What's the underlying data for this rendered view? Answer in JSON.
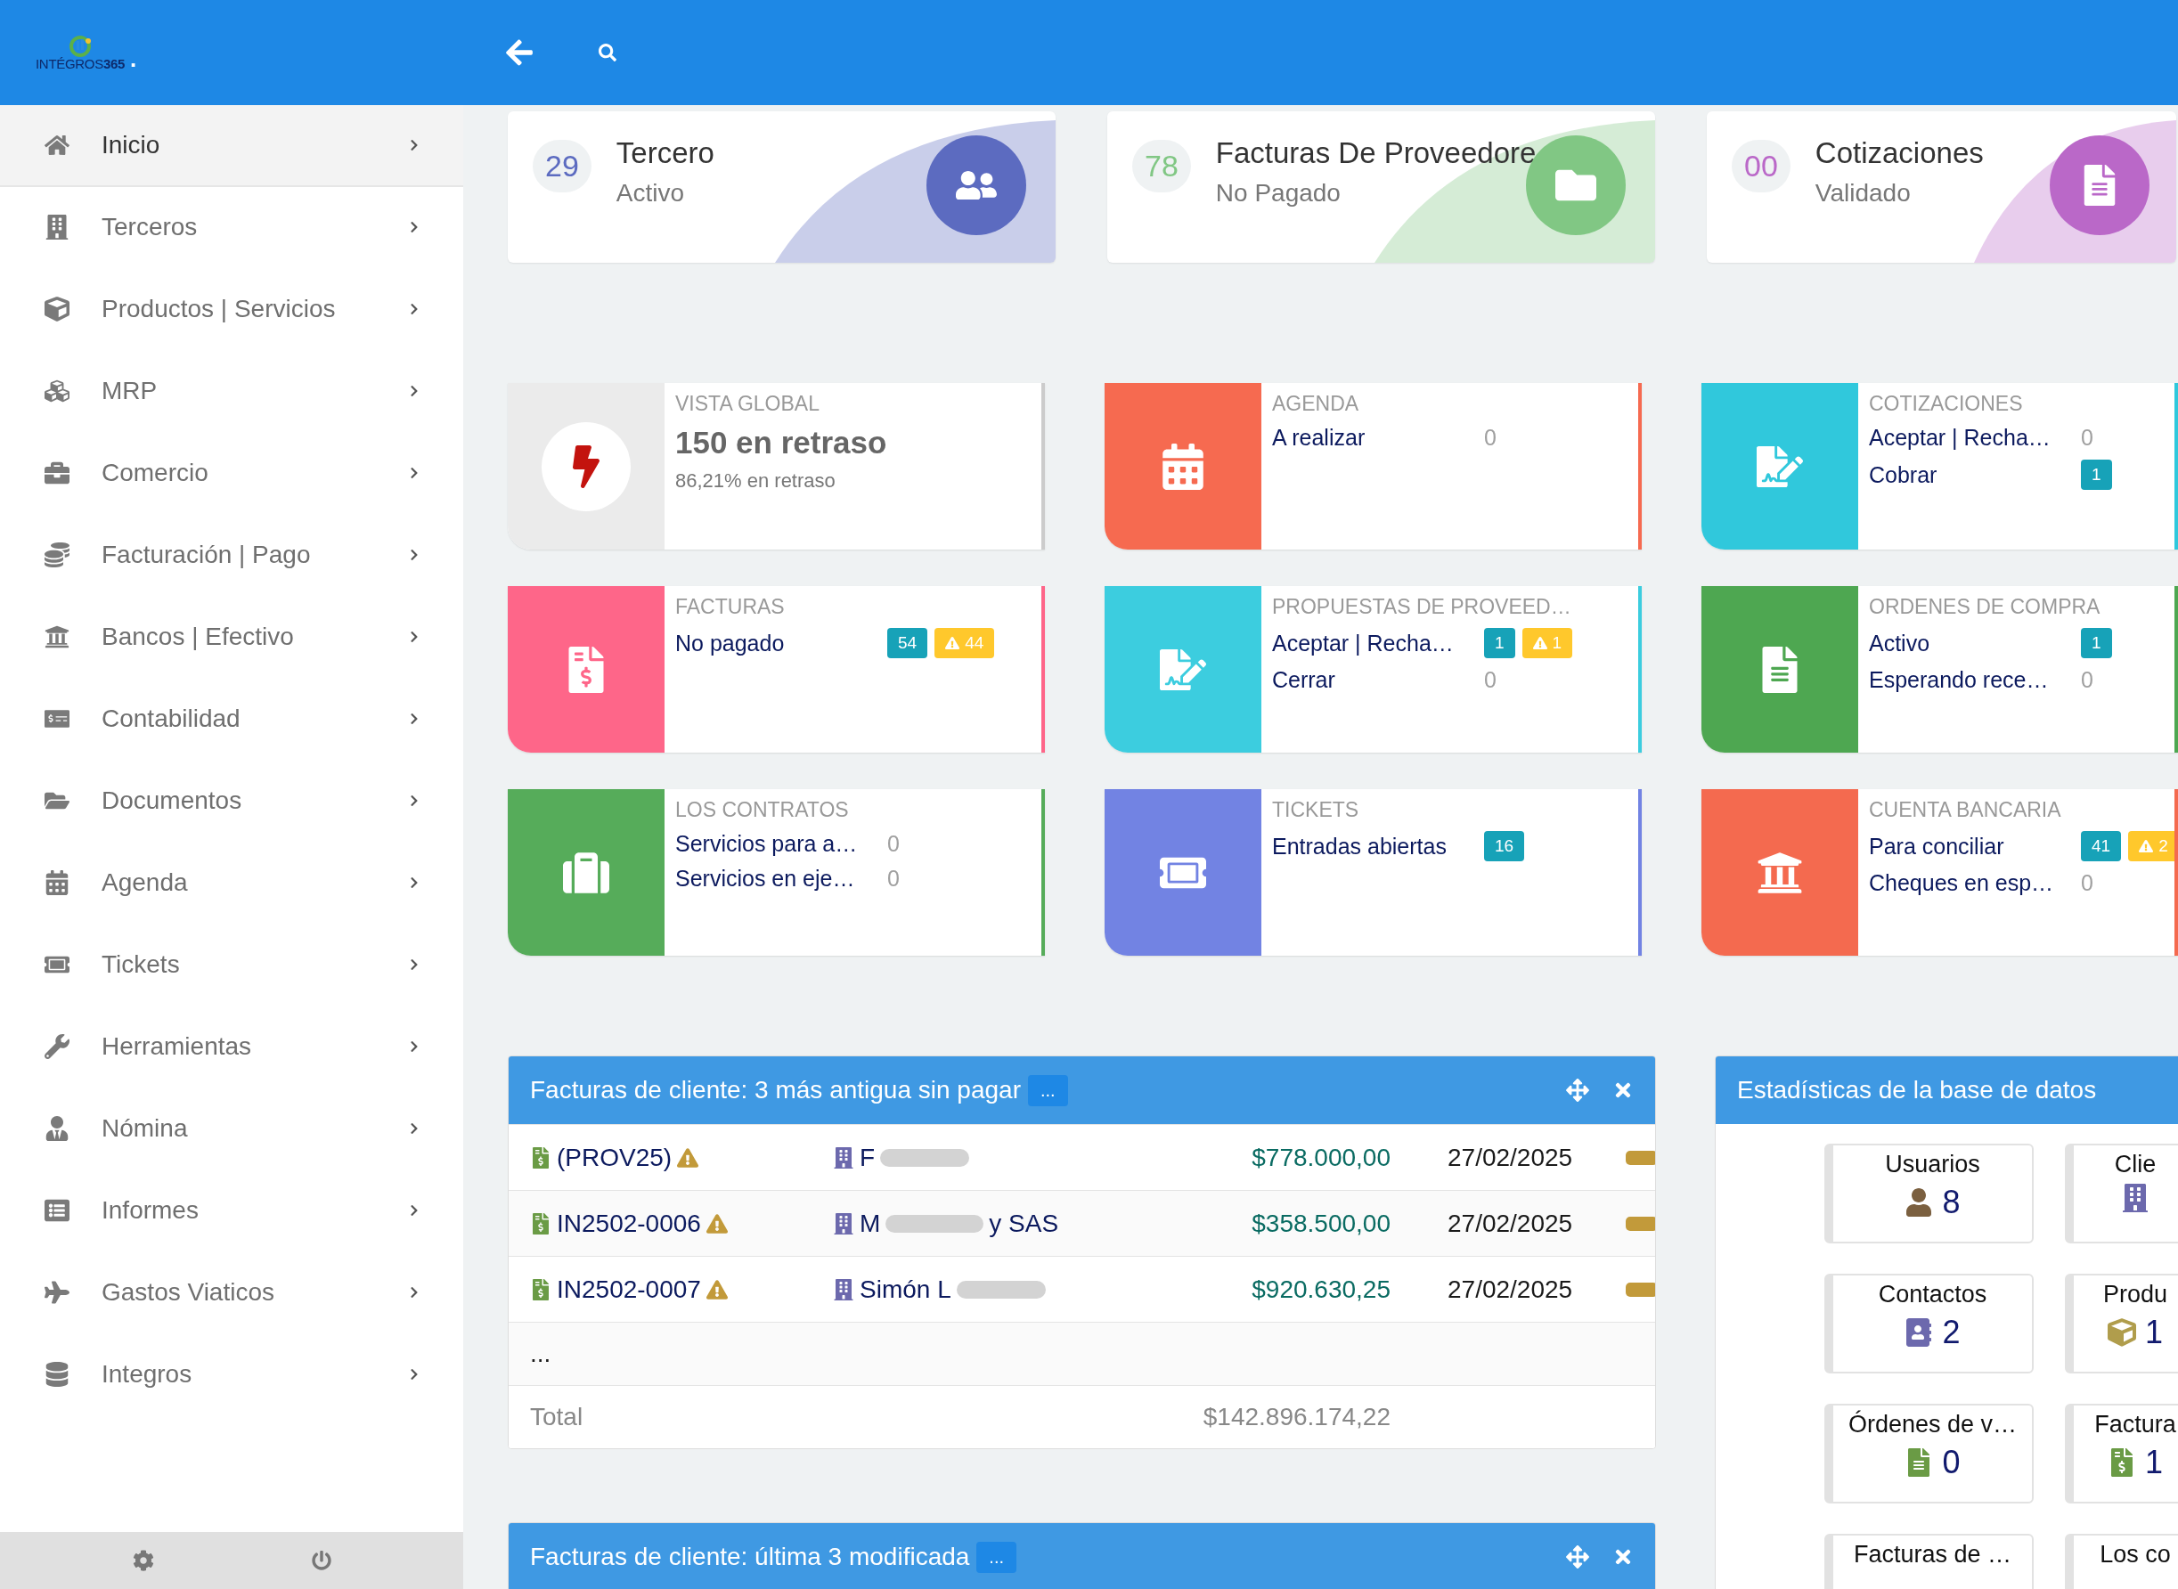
{
  "header": {
    "logo": {
      "name": "INTÉGROS",
      "suffix": "365",
      "dot": "."
    }
  },
  "sidebar": {
    "items": [
      {
        "label": "Inicio",
        "selected": true
      },
      {
        "label": "Terceros",
        "selected": false
      },
      {
        "label": "Productos | Servicios",
        "selected": false
      },
      {
        "label": "MRP",
        "selected": false
      },
      {
        "label": "Comercio",
        "selected": false
      },
      {
        "label": "Facturación | Pago",
        "selected": false
      },
      {
        "label": "Bancos | Efectivo",
        "selected": false
      },
      {
        "label": "Contabilidad",
        "selected": false
      },
      {
        "label": "Documentos",
        "selected": false
      },
      {
        "label": "Agenda",
        "selected": false
      },
      {
        "label": "Tickets",
        "selected": false
      },
      {
        "label": "Herramientas",
        "selected": false
      },
      {
        "label": "Nómina",
        "selected": false
      },
      {
        "label": "Informes",
        "selected": false
      },
      {
        "label": "Gastos Viaticos",
        "selected": false
      },
      {
        "label": "Integros",
        "selected": false
      }
    ]
  },
  "summary_cards": [
    {
      "count": "29",
      "title": "Tercero",
      "subtitle": "Activo",
      "color": "#5c6bc0"
    },
    {
      "count": "78",
      "title": "Facturas De Proveedore",
      "subtitle": "No Pagado",
      "color": "#81c784"
    },
    {
      "count": "00",
      "title": "Cotizaciones",
      "subtitle": "Validado",
      "color": "#ba68c8"
    }
  ],
  "boxes": [
    {
      "kind": "summary",
      "title": "VISTA GLOBAL",
      "value": "150 en retraso",
      "note": "86,21% en retraso",
      "color": "#ebebeb"
    },
    {
      "kind": "list",
      "title": "AGENDA",
      "color": "#f66a50",
      "lines": [
        {
          "label": "A realizar",
          "value": "0"
        }
      ]
    },
    {
      "kind": "list",
      "title": "COTIZACIONES",
      "color": "#30c8dc",
      "lines": [
        {
          "label": "Aceptar | Recha…",
          "value": "0"
        },
        {
          "label": "Cobrar",
          "badges": [
            {
              "kind": "info",
              "text": "1"
            }
          ]
        }
      ]
    },
    {
      "kind": "list",
      "title": "FACTURAS",
      "color": "#fe6689",
      "lines": [
        {
          "label": "No pagado",
          "badges": [
            {
              "kind": "info",
              "text": "54"
            },
            {
              "kind": "warning",
              "text": "44"
            }
          ]
        }
      ]
    },
    {
      "kind": "list",
      "title": "PROPUESTAS DE PROVEED…",
      "color": "#3ccddf",
      "lines": [
        {
          "label": "Aceptar | Recha…",
          "badges": [
            {
              "kind": "info",
              "text": "1"
            },
            {
              "kind": "warning",
              "text": "1"
            }
          ]
        },
        {
          "label": "Cerrar",
          "value": "0"
        }
      ]
    },
    {
      "kind": "list",
      "title": "ORDENES DE COMPRA",
      "color": "#4ea751",
      "lines": [
        {
          "label": "Activo",
          "badges": [
            {
              "kind": "info",
              "text": "1"
            }
          ]
        },
        {
          "label": "Esperando rece…",
          "value": "0"
        }
      ]
    },
    {
      "kind": "list",
      "title": "LOS CONTRATOS",
      "color": "#56ac5a",
      "lines": [
        {
          "label": "Servicios para a…",
          "value": "0"
        },
        {
          "label": "Servicios en eje…",
          "value": "0"
        }
      ]
    },
    {
      "kind": "list",
      "title": "TICKETS",
      "color": "#7283e3",
      "lines": [
        {
          "label": "Entradas abiertas",
          "badges": [
            {
              "kind": "info",
              "text": "16"
            }
          ]
        }
      ]
    },
    {
      "kind": "list",
      "title": "CUENTA BANCARIA",
      "color": "#f46a4f",
      "lines": [
        {
          "label": "Para conciliar",
          "badges": [
            {
              "kind": "info",
              "text": "41"
            },
            {
              "kind": "warning",
              "text": "2"
            }
          ]
        },
        {
          "label": "Cheques en esp…",
          "value": "0"
        }
      ]
    }
  ],
  "unpaid_panel": {
    "title": "Facturas de cliente: 3 más antigua sin pagar",
    "more": "...",
    "rows": [
      {
        "ref": "(PROV25)",
        "customer_before": "F",
        "customer_after": "",
        "amount": "$778.000,00",
        "date": "27/02/2025",
        "color": "#c29a3a"
      },
      {
        "ref": "IN2502-0006",
        "customer_before": "M",
        "customer_after": "y SAS",
        "amount": "$358.500,00",
        "date": "27/02/2025",
        "color": "#c29a3a"
      },
      {
        "ref": "IN2502-0007",
        "customer_before": "Simón L",
        "customer_after": "",
        "amount": "$920.630,25",
        "date": "27/02/2025",
        "color": "#c29a3a"
      }
    ],
    "ellipsis": "...",
    "total_label": "Total",
    "total": "$142.896.174,22"
  },
  "modified_panel": {
    "title": "Facturas de cliente: última 3 modificada",
    "more": "..."
  },
  "stats_panel": {
    "title": "Estadísticas de la base de datos",
    "stats": [
      {
        "label": "Usuarios",
        "value": "8"
      },
      {
        "label": "Clie"
      },
      {
        "label": "Contactos",
        "value": "2"
      },
      {
        "label": "Produ",
        "value": "1"
      },
      {
        "label": "Órdenes de v…",
        "value": "0"
      },
      {
        "label": "Factura",
        "value": "1"
      },
      {
        "label": "Facturas de …"
      },
      {
        "label": "Los co"
      }
    ]
  }
}
